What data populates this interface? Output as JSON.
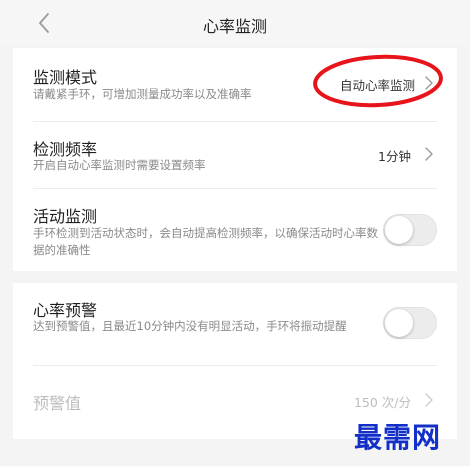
{
  "nav": {
    "title": "心率监测"
  },
  "settings": {
    "mode": {
      "title": "监测模式",
      "desc": "请戴紧手环，可增加测量成功率以及准确率",
      "value": "自动心率监测"
    },
    "frequency": {
      "title": "检测频率",
      "desc": "开启自动心率监测时需要设置频率",
      "value": "1分钟"
    },
    "activity": {
      "title": "活动监测",
      "desc": "手环检测到活动状态时，会自动提高检测频率，以确保活动时心率数据的准确性",
      "toggle_on": false
    },
    "alert": {
      "title": "心率预警",
      "desc": "达到预警值，且最近10分钟内没有明显活动，手环将振动提醒",
      "toggle_on": false
    },
    "threshold": {
      "title": "预警值",
      "value": "150 次/分",
      "enabled": false
    }
  },
  "annotation": {
    "shape": "red-ellipse",
    "color": "#e8141c"
  },
  "watermark": {
    "text": "最需网",
    "color": "#1230c8"
  }
}
